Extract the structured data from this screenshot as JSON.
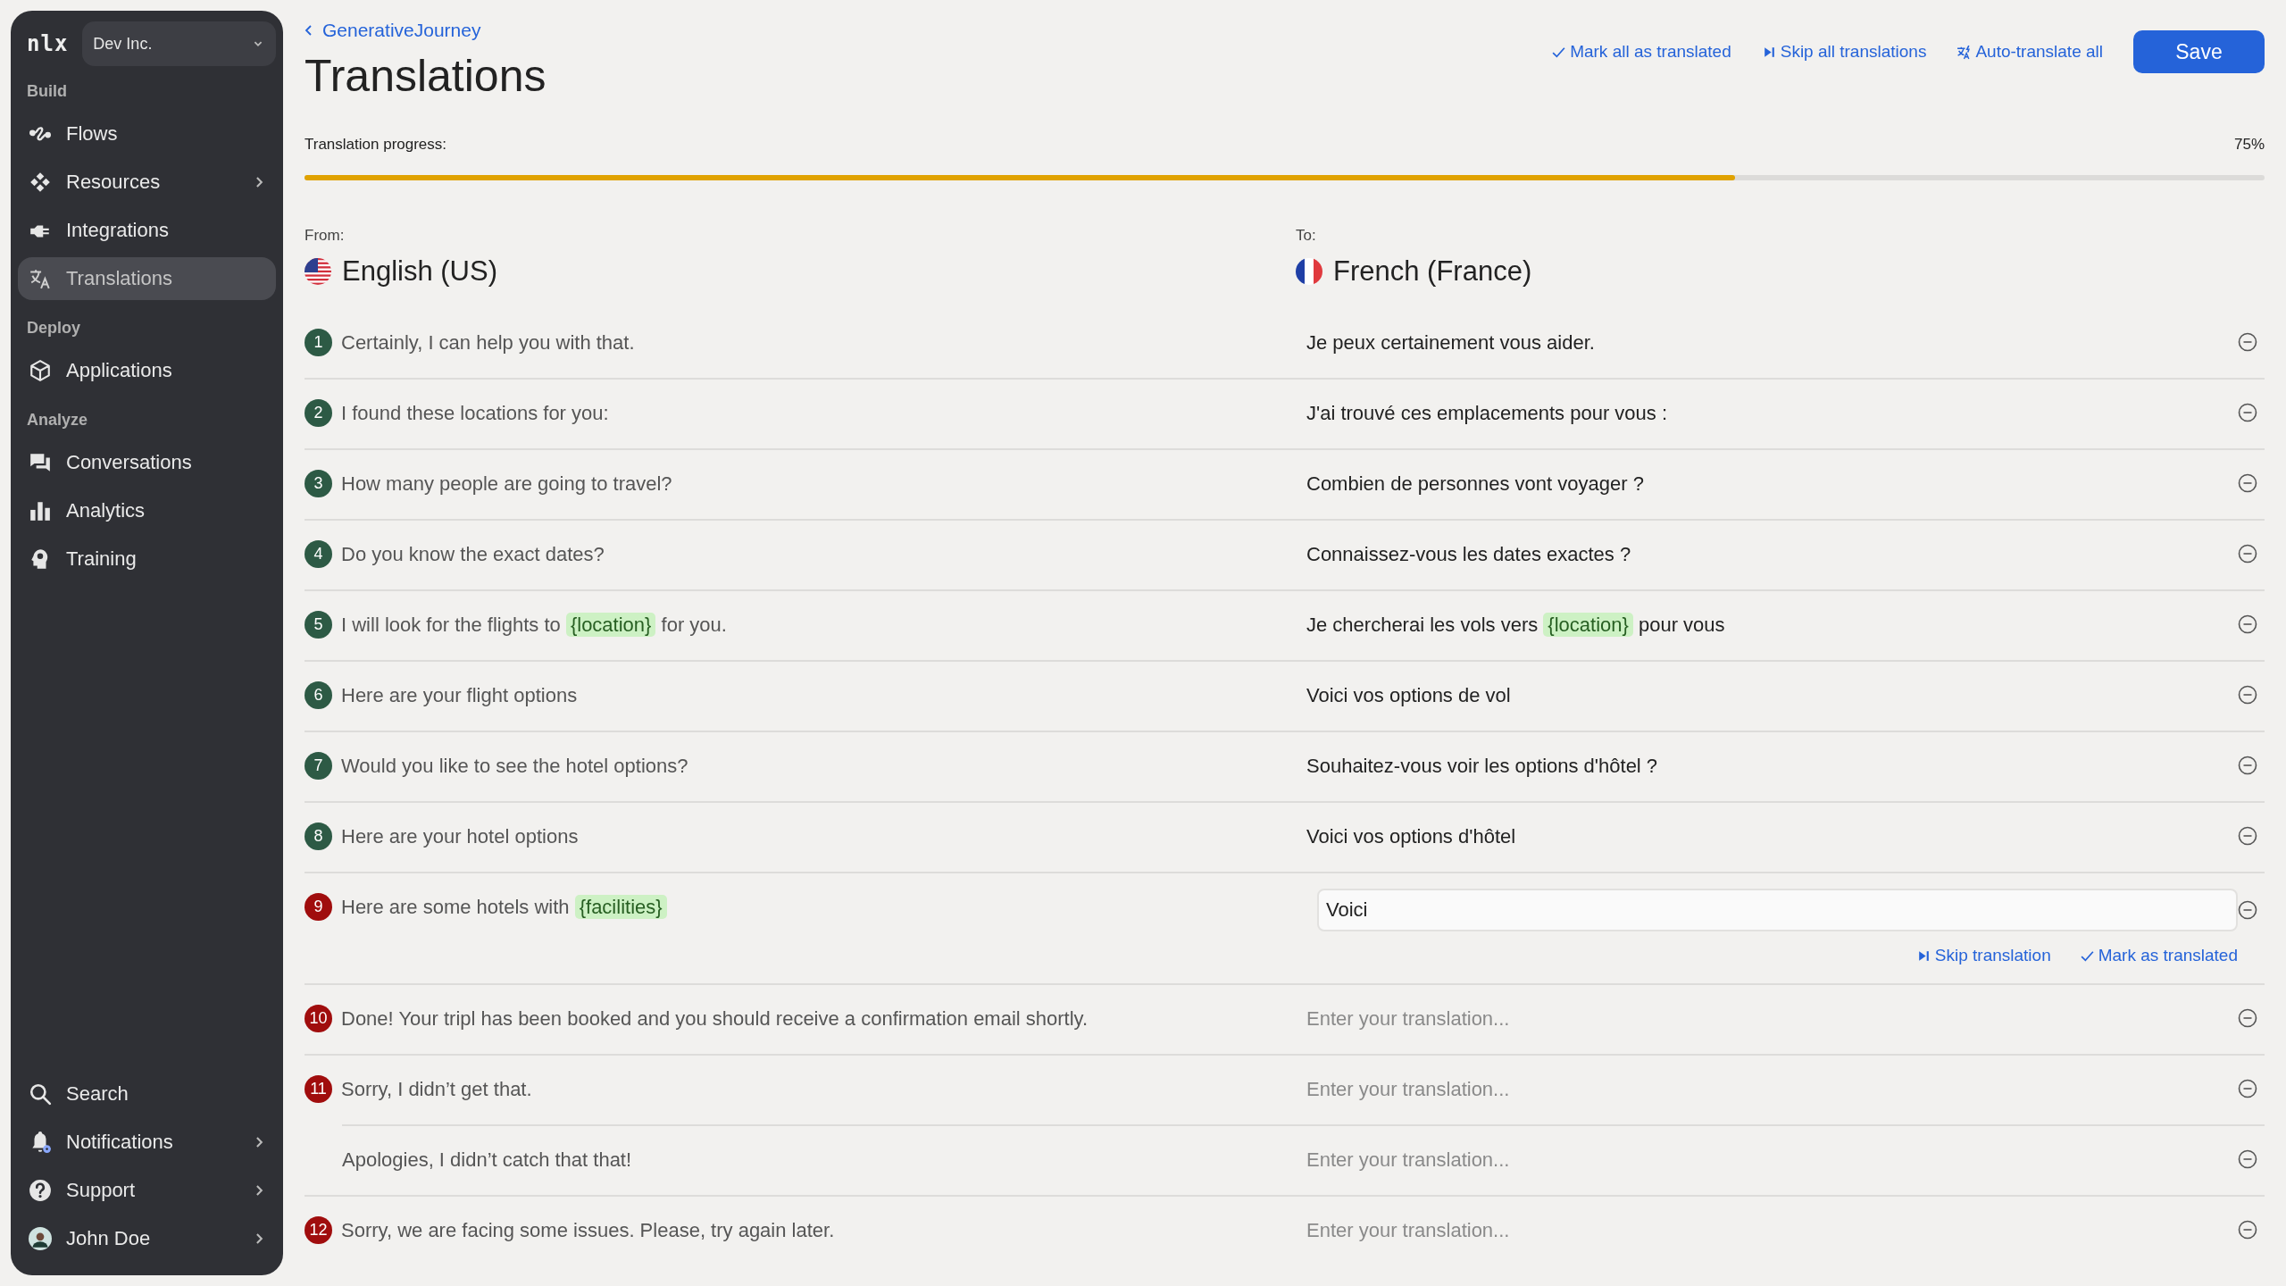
{
  "sidebar": {
    "logo": "nlx",
    "workspace": "Dev Inc.",
    "sections": [
      {
        "title": "Build",
        "items": [
          {
            "label": "Flows",
            "expandable": false,
            "selected": false
          },
          {
            "label": "Resources",
            "expandable": true,
            "selected": false
          },
          {
            "label": "Integrations",
            "expandable": false,
            "selected": false
          },
          {
            "label": "Translations",
            "expandable": false,
            "selected": true
          }
        ]
      },
      {
        "title": "Deploy",
        "items": [
          {
            "label": "Applications",
            "expandable": false,
            "selected": false
          }
        ]
      },
      {
        "title": "Analyze",
        "items": [
          {
            "label": "Conversations",
            "expandable": false,
            "selected": false
          },
          {
            "label": "Analytics",
            "expandable": false,
            "selected": false
          },
          {
            "label": "Training",
            "expandable": false,
            "selected": false
          }
        ]
      }
    ],
    "footer": [
      {
        "label": "Search",
        "expandable": false
      },
      {
        "label": "Notifications",
        "expandable": true
      },
      {
        "label": "Support",
        "expandable": true
      },
      {
        "label": "John Doe",
        "expandable": true
      }
    ]
  },
  "header": {
    "back": "GenerativeJourney",
    "title": "Translations",
    "actions": [
      "Mark all as translated",
      "Skip all translations",
      "Auto-translate all"
    ],
    "save": "Save"
  },
  "progress": {
    "label": "Translation progress:",
    "reading": "75%",
    "level": 0.73
  },
  "from": {
    "caption": "From:",
    "language": "English (US)"
  },
  "to": {
    "caption": "To:",
    "language": "French (France)"
  },
  "rows": [
    {
      "number": "1",
      "color": "#2d5a45",
      "source": [
        {
          "kind": "text",
          "text": "Certainly, I can help you with that."
        }
      ],
      "target": {
        "kind": "text",
        "parts": [
          {
            "kind": "text",
            "text": "Je peux certainement vous aider."
          }
        ]
      }
    },
    {
      "number": "2",
      "color": "#2d5a45",
      "source": [
        {
          "kind": "text",
          "text": "I found these locations for you:"
        }
      ],
      "target": {
        "kind": "text",
        "parts": [
          {
            "kind": "text",
            "text": "J'ai trouvé ces emplacements pour vous :"
          }
        ]
      }
    },
    {
      "number": "3",
      "color": "#2d5a45",
      "source": [
        {
          "kind": "text",
          "text": "How many people are going to travel?"
        }
      ],
      "target": {
        "kind": "text",
        "parts": [
          {
            "kind": "text",
            "text": "Combien de personnes vont voyager ?"
          }
        ]
      }
    },
    {
      "number": "4",
      "color": "#2d5a45",
      "source": [
        {
          "kind": "text",
          "text": "Do you know the exact dates?"
        }
      ],
      "target": {
        "kind": "text",
        "parts": [
          {
            "kind": "text",
            "text": "Connaissez-vous les dates exactes ?"
          }
        ]
      }
    },
    {
      "number": "5",
      "color": "#2d5a45",
      "source": [
        {
          "kind": "text",
          "text": "I will look for the flights to "
        },
        {
          "kind": "variable",
          "text": "{location}"
        },
        {
          "kind": "text",
          "text": " for you."
        }
      ],
      "target": {
        "kind": "text",
        "parts": [
          {
            "kind": "text",
            "text": "Je chercherai les vols vers "
          },
          {
            "kind": "variable",
            "text": "{location}"
          },
          {
            "kind": "text",
            "text": " pour vous"
          }
        ]
      }
    },
    {
      "number": "6",
      "color": "#2d5a45",
      "source": [
        {
          "kind": "text",
          "text": "Here are your flight options"
        }
      ],
      "target": {
        "kind": "text",
        "parts": [
          {
            "kind": "text",
            "text": "Voici vos options de vol"
          }
        ]
      }
    },
    {
      "number": "7",
      "color": "#2d5a45",
      "source": [
        {
          "kind": "text",
          "text": "Would you like to see the hotel options?"
        }
      ],
      "target": {
        "kind": "text",
        "parts": [
          {
            "kind": "text",
            "text": "Souhaitez-vous voir les options d'hôtel ?"
          }
        ]
      }
    },
    {
      "number": "8",
      "color": "#2d5a45",
      "source": [
        {
          "kind": "text",
          "text": "Here are your hotel options"
        }
      ],
      "target": {
        "kind": "text",
        "parts": [
          {
            "kind": "text",
            "text": "Voici vos options d'hôtel"
          }
        ]
      }
    },
    {
      "number": "9",
      "color": "#a00d0d",
      "source": [
        {
          "kind": "text",
          "text": "Here are some hotels with "
        },
        {
          "kind": "variable",
          "text": "{facilities}"
        }
      ],
      "target": {
        "kind": "input",
        "value": "Voici",
        "actions": [
          "Skip translation",
          "Mark as translated"
        ]
      }
    },
    {
      "number": "10",
      "color": "#a00d0d",
      "source": [
        {
          "kind": "text",
          "text": "Done! Your tripl has been booked and you should receive a confirmation email shortly."
        }
      ],
      "target": {
        "kind": "empty",
        "placeholder": "Enter your translation..."
      }
    },
    {
      "number": "11",
      "color": "#a00d0d",
      "source": [
        {
          "kind": "text",
          "text": "Sorry, I didn’t get that."
        }
      ],
      "target": {
        "kind": "empty",
        "placeholder": "Enter your translation..."
      }
    },
    {
      "source": [
        {
          "kind": "text",
          "text": "Apologies, I didn’t catch that that!"
        }
      ],
      "target": {
        "kind": "empty",
        "placeholder": "Enter your translation..."
      }
    },
    {
      "number": "12",
      "color": "#a00d0d",
      "source": [
        {
          "kind": "text",
          "text": "Sorry, we are facing some issues. Please, try again later."
        }
      ],
      "target": {
        "kind": "empty",
        "placeholder": "Enter your translation..."
      }
    }
  ]
}
